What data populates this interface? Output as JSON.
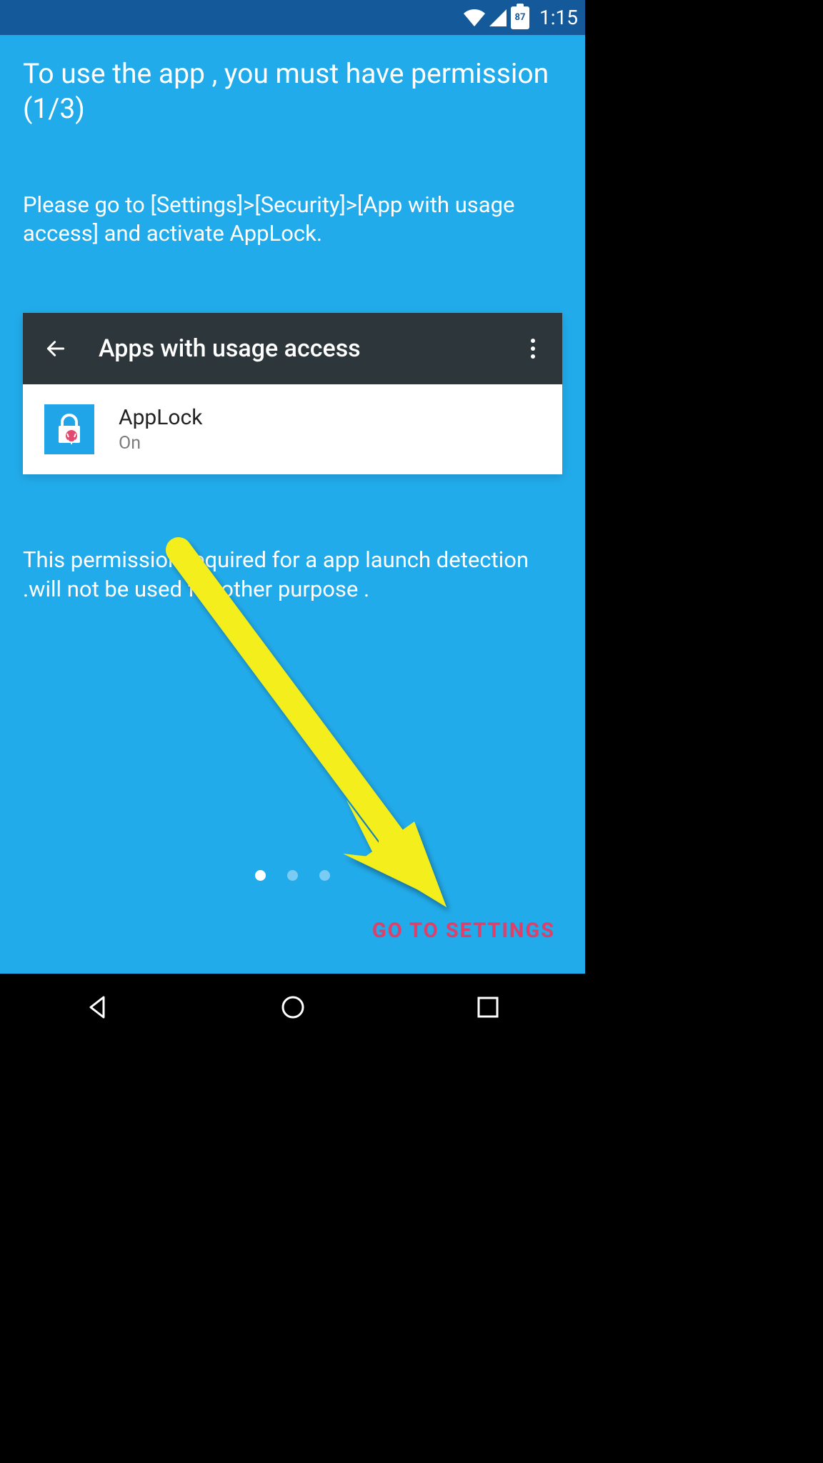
{
  "status": {
    "battery_percent": "87",
    "time": "1:15"
  },
  "title": "To use the app , you must have permission (1/3)",
  "instructions": "Please go to [Settings]>[Security]>[App with usage access] and activate AppLock.",
  "preview": {
    "header_title": "Apps with usage access",
    "app_name": "AppLock",
    "app_status": "On"
  },
  "footer_note": "This permission required for a app launch detection .will not be used for other purpose .",
  "pager": {
    "count": 3,
    "active_index": 0
  },
  "cta_label": "GO TO SETTINGS"
}
